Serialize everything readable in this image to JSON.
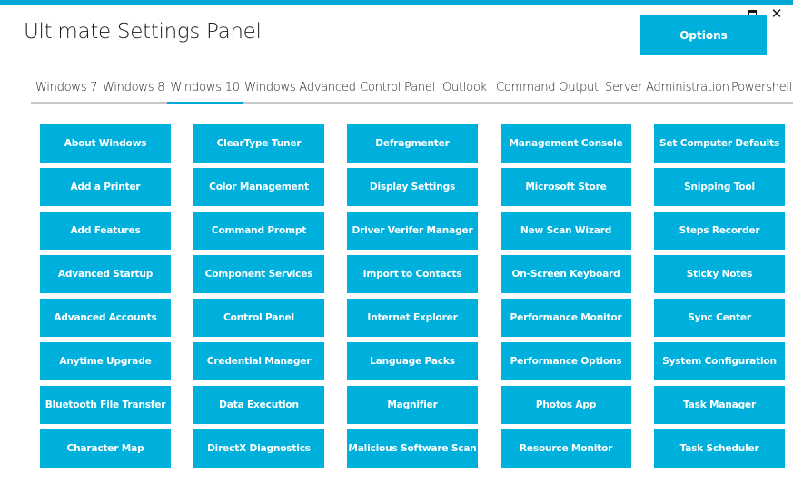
{
  "window": {
    "title": "Ultimate Settings Panel",
    "maximize_icon": "maximize-icon",
    "close_icon": "close-icon",
    "close_glyph": "✕",
    "accent_color": "#00b0dc"
  },
  "header": {
    "options_label": "Options"
  },
  "tabs": [
    {
      "label": "Windows 7",
      "active": false
    },
    {
      "label": "Windows 8",
      "active": false
    },
    {
      "label": "Windows 10",
      "active": true
    },
    {
      "label": "Windows Advanced",
      "active": false
    },
    {
      "label": "Control Panel",
      "active": false
    },
    {
      "label": "Outlook",
      "active": false
    },
    {
      "label": "Command Output",
      "active": false
    },
    {
      "label": "Server Administration",
      "active": false
    },
    {
      "label": "Powershell",
      "active": false
    }
  ],
  "tiles": {
    "columns": [
      [
        "About Windows",
        "Add a Printer",
        "Add Features",
        "Advanced Startup",
        "Advanced Accounts",
        "Anytime Upgrade",
        "Bluetooth File Transfer",
        "Character Map"
      ],
      [
        "ClearType Tuner",
        "Color Management",
        "Command Prompt",
        "Component Services",
        "Control Panel",
        "Credential Manager",
        "Data Execution",
        "DirectX Diagnostics"
      ],
      [
        "Defragmenter",
        "Display Settings",
        "Driver Verifer Manager",
        "Import to Contacts",
        "Internet Explorer",
        "Language Packs",
        "Magnifier",
        "Malicious Software Scan"
      ],
      [
        "Management Console",
        "Microsoft Store",
        "New Scan Wizard",
        "On-Screen Keyboard",
        "Performance Monitor",
        "Performance Options",
        "Photos App",
        "Resource Monitor"
      ],
      [
        "Set Computer Defaults",
        "Snipping Tool",
        "Steps Recorder",
        "Sticky Notes",
        "Sync Center",
        "System Configuration",
        "Task Manager",
        "Task Scheduler"
      ]
    ]
  }
}
